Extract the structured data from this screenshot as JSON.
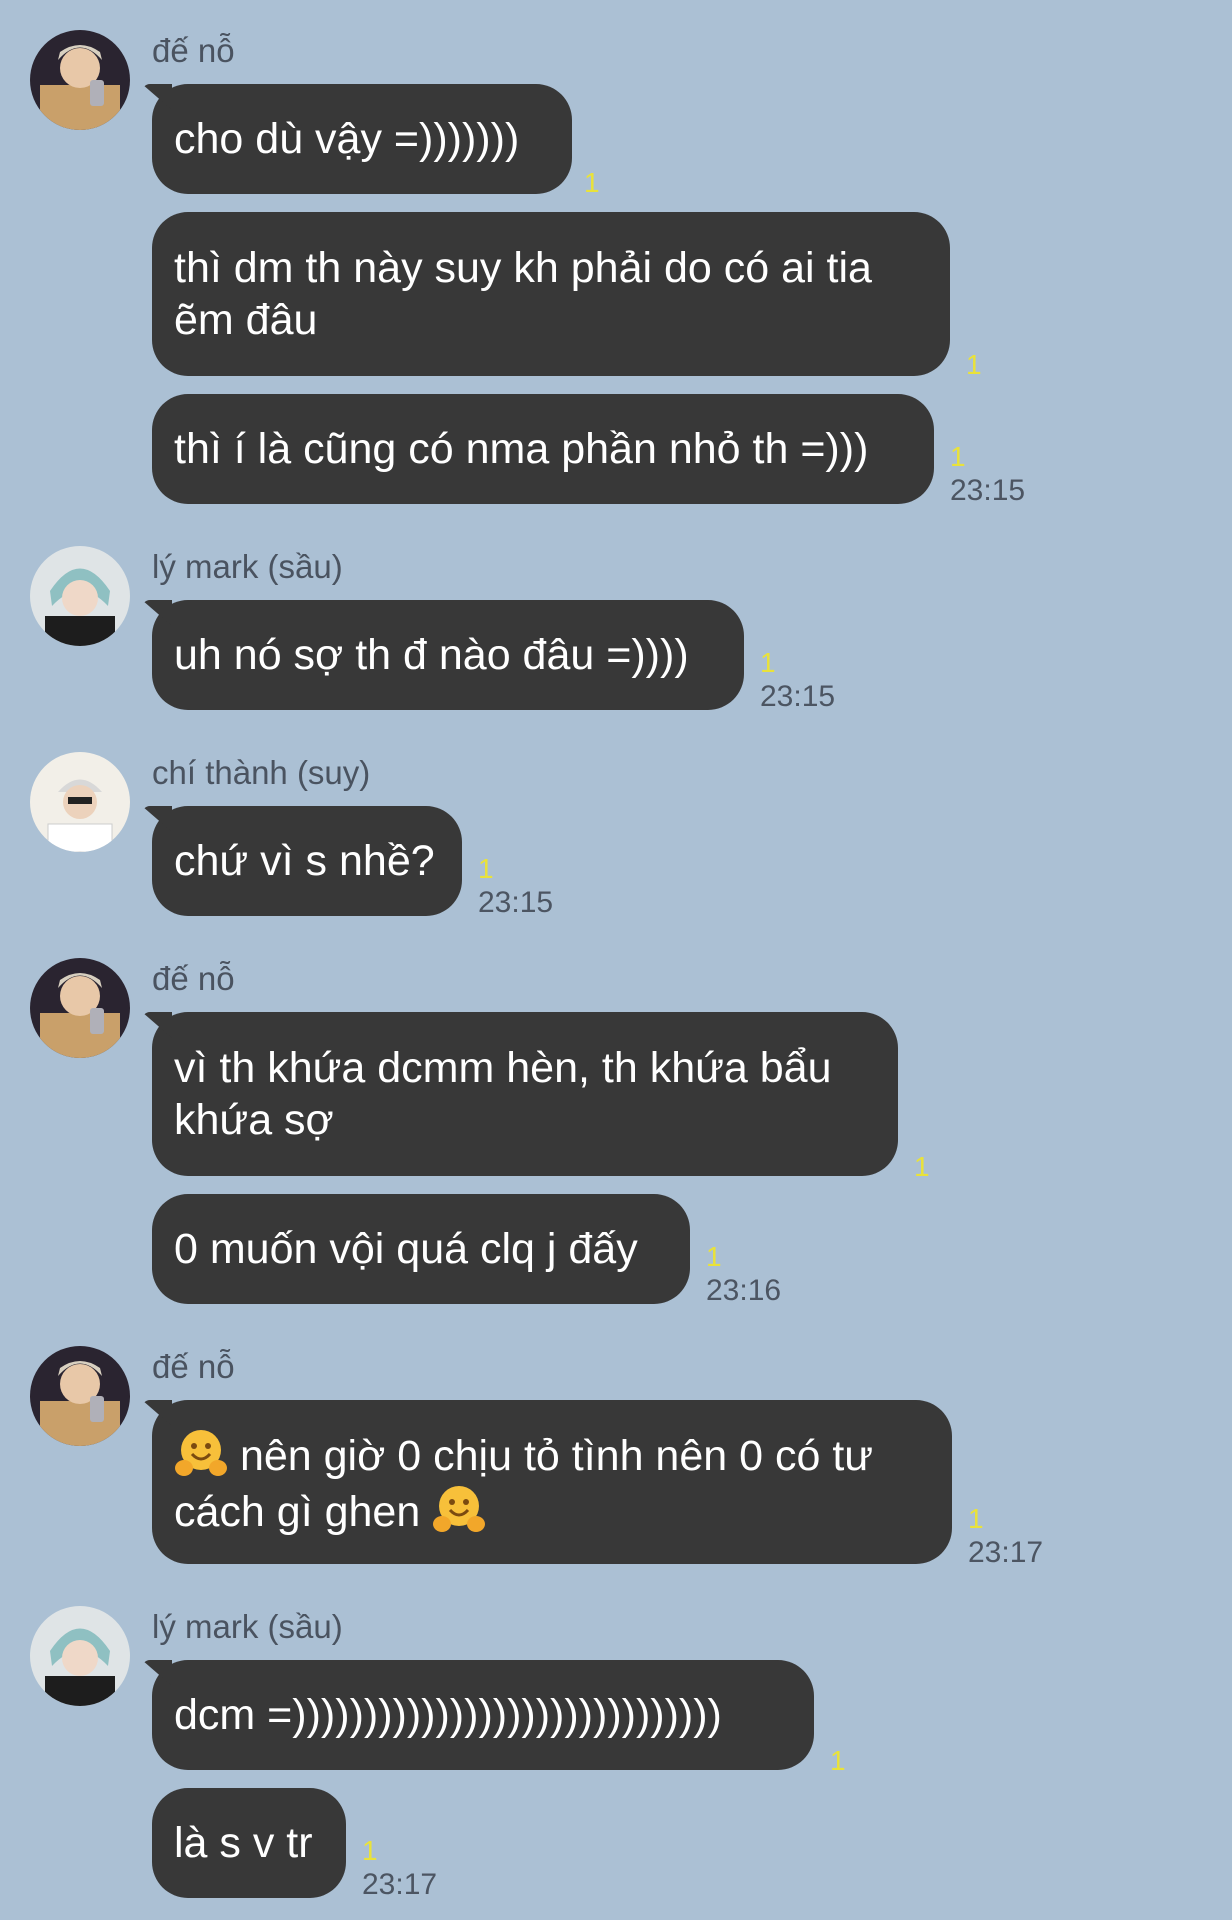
{
  "messages": [
    {
      "sender": "đế nỗ",
      "avatar": "avatar-de-no",
      "bubbles": [
        {
          "text": "cho dù vậy =)))))))",
          "read": "1",
          "time": ""
        },
        {
          "text": "thì dm th này suy kh phải do có ai tia ẽm đâu",
          "read": "1",
          "time": ""
        },
        {
          "text": "thì í là cũng có nma phần nhỏ th =)))",
          "read": "1",
          "time": "23:15"
        }
      ]
    },
    {
      "sender": "lý mark (sầu)",
      "avatar": "avatar-ly-mark",
      "bubbles": [
        {
          "text": "uh nó sợ th đ nào đâu =))))",
          "read": "1",
          "time": "23:15"
        }
      ]
    },
    {
      "sender": "chí thành (suy)",
      "avatar": "avatar-chi-thanh",
      "bubbles": [
        {
          "text": "chứ vì s nhề?",
          "read": "1",
          "time": "23:15"
        }
      ]
    },
    {
      "sender": "đế nỗ",
      "avatar": "avatar-de-no",
      "bubbles": [
        {
          "text": "vì th khứa dcmm hèn, th khứa bẩu khứa sợ",
          "read": "1",
          "time": ""
        },
        {
          "text": "0 muốn vội quá clq j đấy",
          "read": "1",
          "time": "23:16"
        }
      ]
    },
    {
      "sender": "đế nỗ",
      "avatar": "avatar-de-no",
      "bubbles": [
        {
          "text_before": "nên giờ 0 chịu tỏ tình nên 0 có tư cách gì ghen",
          "emoji": "hugging-face-emoji",
          "read": "1",
          "time": "23:17"
        }
      ]
    },
    {
      "sender": "lý mark (sầu)",
      "avatar": "avatar-ly-mark",
      "bubbles": [
        {
          "text": "dcm =))))))))))))))))))))))))))))))",
          "read": "1",
          "time": ""
        },
        {
          "text": "là s v tr",
          "read": "1",
          "time": "23:17"
        }
      ]
    }
  ]
}
